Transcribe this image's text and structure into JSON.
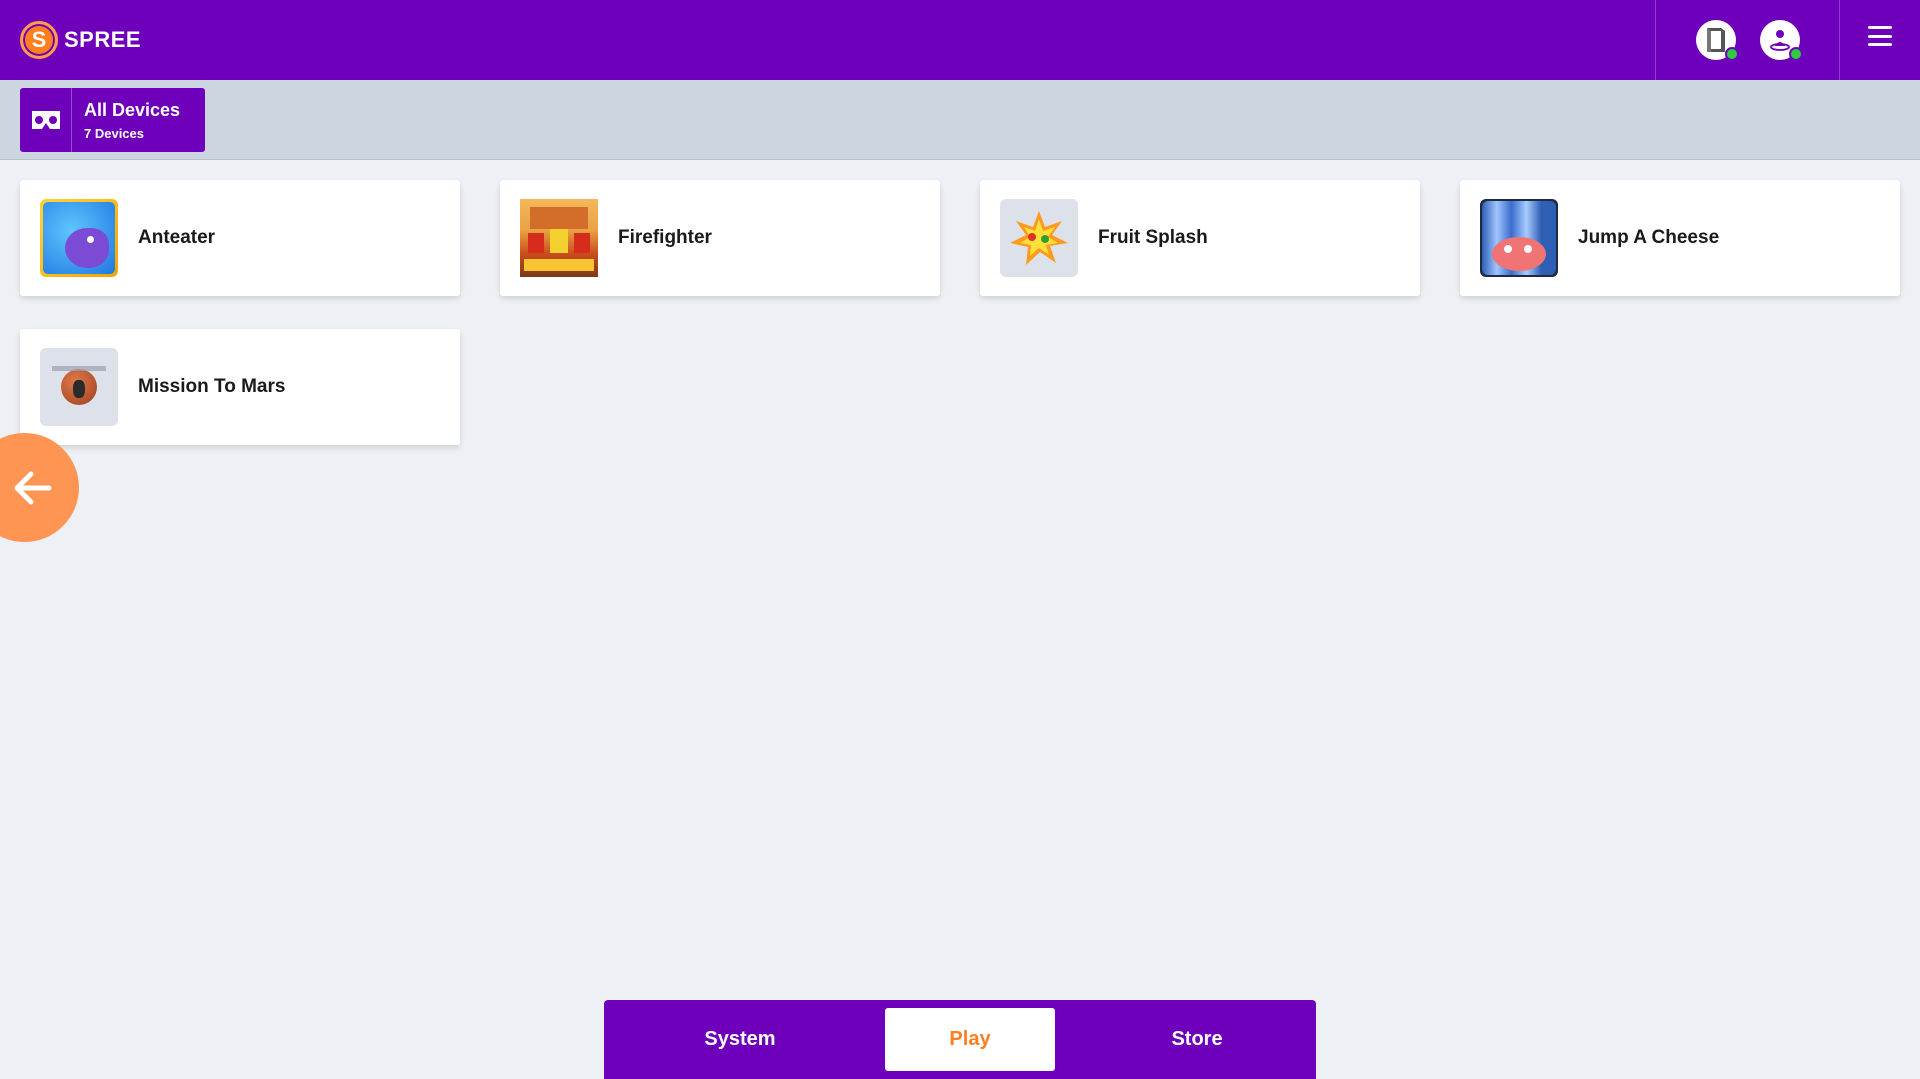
{
  "header": {
    "logo_letter": "S",
    "logo_text": "SPREE",
    "status_icons": [
      "headset-icon",
      "vr-user-icon"
    ],
    "menu_icon": "hamburger-menu-icon"
  },
  "device_selector": {
    "title": "All Devices",
    "subtitle": "7 Devices",
    "icon": "vr-headset-icon"
  },
  "games": [
    {
      "name": "Anteater"
    },
    {
      "name": "Firefighter"
    },
    {
      "name": "Fruit Splash"
    },
    {
      "name": "Jump A Cheese"
    },
    {
      "name": "Mission To Mars"
    }
  ],
  "back_button": {
    "icon": "arrow-left-icon"
  },
  "bottom_nav": {
    "tabs": [
      {
        "label": "System"
      },
      {
        "label": "Play"
      },
      {
        "label": "Store"
      }
    ],
    "active": "Play"
  },
  "colors": {
    "brand_purple": "#6e00bb",
    "accent_orange": "#ff7e1f",
    "status_online": "#2ecc40"
  }
}
